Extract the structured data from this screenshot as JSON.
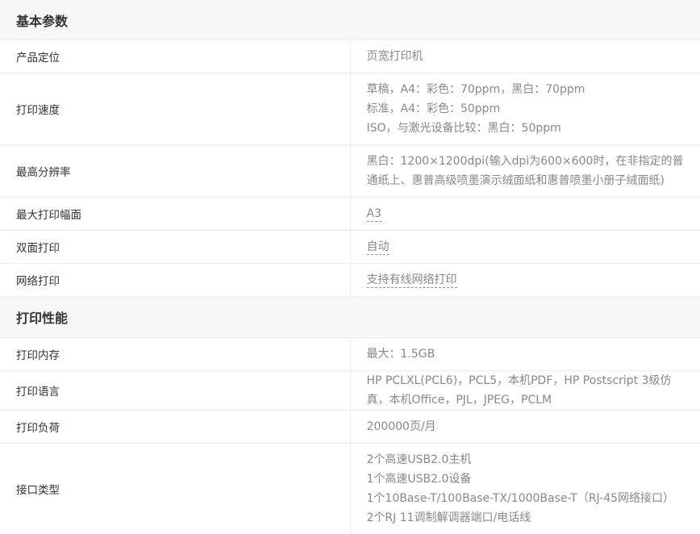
{
  "sections": [
    {
      "title": "基本参数",
      "rows": [
        {
          "label": "产品定位",
          "values": [
            "页宽打印机"
          ]
        },
        {
          "label": "打印速度",
          "values": [
            "草稿，A4：彩色：70ppm，黑白：70ppm",
            "标准，A4：彩色：50ppm",
            "ISO，与激光设备比较：黑白：50ppm"
          ]
        },
        {
          "label": "最高分辨率",
          "values": [
            "黑白：1200×1200dpi(输入dpi为600×600时，在非指定的普通纸上、惠普高级喷墨演示绒面纸和惠普喷墨小册子绒面纸)"
          ]
        },
        {
          "label": "最大打印幅面",
          "values": [
            "A3"
          ]
        },
        {
          "label": "双面打印",
          "values": [
            "自动"
          ]
        },
        {
          "label": "网络打印",
          "values": [
            "支持有线网络打印"
          ]
        }
      ]
    },
    {
      "title": "打印性能",
      "rows": [
        {
          "label": "打印内存",
          "values": [
            "最大：1.5GB"
          ]
        },
        {
          "label": "打印语言",
          "values": [
            "HP PCLXL(PCL6)，PCL5，本机PDF，HP Postscript 3级仿真，本机Office，PJL，JPEG，PCLM"
          ]
        },
        {
          "label": "打印负荷",
          "values": [
            "200000页/月"
          ]
        },
        {
          "label": "接口类型",
          "values": [
            "2个高速USB2.0主机",
            "1个高速USB2.0设备",
            "1个10Base-T/100Base-TX/1000Base-T（RJ-45网络接口）",
            "2个RJ 11调制解调器端口/电话线"
          ]
        }
      ]
    }
  ]
}
